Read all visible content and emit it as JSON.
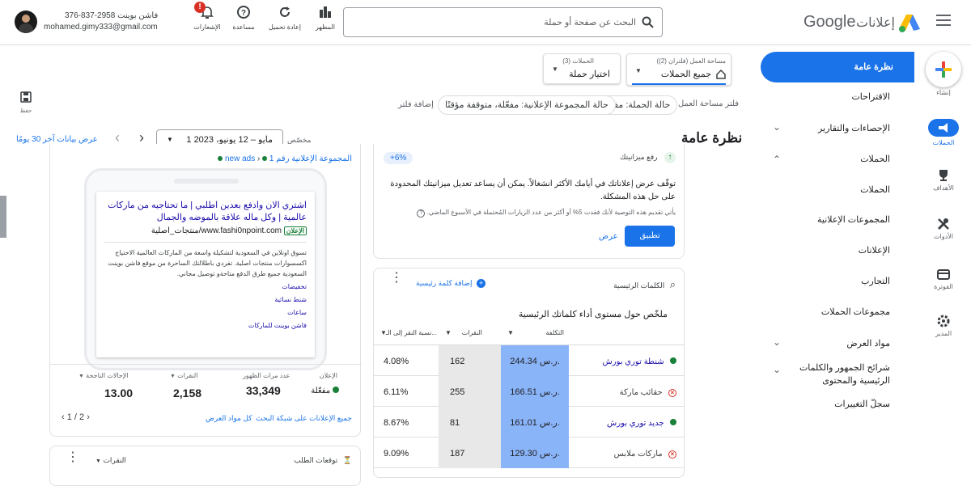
{
  "header": {
    "product_name": "إعلانات",
    "brand": "Google",
    "search_placeholder": "البحث عن صفحة أو حملة",
    "tools": [
      {
        "label": "المظهر",
        "icon": "appearance-icon"
      },
      {
        "label": "إعادة تحميل",
        "icon": "refresh-icon"
      },
      {
        "label": "مساعدة",
        "icon": "help-icon"
      },
      {
        "label": "الإشعارات",
        "icon": "bell-icon",
        "badge": "!"
      }
    ],
    "account": {
      "name": "376-837-2958 فاشن بوينت",
      "email": "mohamed.gimy333@gmail.com"
    }
  },
  "selectors": {
    "workspace_label": "مساحة العمل (فلتران (2))",
    "workspace_value": "جميع الحملات",
    "campaigns_label": "الحملات (3)",
    "campaigns_value": "اختيار حملة"
  },
  "filters": {
    "label": "فلتر مساحة العمل",
    "chips": [
      "حالة الحملة: مفعّلة",
      "حالة المجموعة الإعلانية: مفعّلة، متوقفة مؤقتًا"
    ],
    "add": "إضافة فلتر",
    "save": "حفظ"
  },
  "page": {
    "title": "نظرة عامة",
    "range_type": "مخصّص",
    "range": "1 مايو – 12 يونيو، 2023",
    "last30": "عرض بيانات آخر 30 يومًا"
  },
  "left_nav": {
    "overview": "نظرة عامة",
    "items": [
      {
        "label": "الاقتراحات"
      },
      {
        "label": "الإحصاءات والتقارير",
        "chevron": "down"
      },
      {
        "label": "الحملات",
        "chevron": "up"
      },
      {
        "label": "الحملات"
      },
      {
        "label": "المجموعات الإعلانية"
      },
      {
        "label": "الإعلانات"
      },
      {
        "label": "التجارب"
      },
      {
        "label": "مجموعات الحملات"
      },
      {
        "label": "مواد العرض",
        "chevron": "down"
      },
      {
        "label": "شرائح الجمهور والكلمات الرئيسية والمحتوى",
        "chevron": "down"
      },
      {
        "label": "سجلّ التغييرات"
      }
    ]
  },
  "rail": [
    {
      "label": "إنشاء",
      "icon": "plus-icon"
    },
    {
      "label": "الحملات",
      "icon": "campaigns-icon",
      "active": true
    },
    {
      "label": "الأهداف",
      "icon": "trophy-icon"
    },
    {
      "label": "الأدوات",
      "icon": "tools-icon"
    },
    {
      "label": "الفوترة",
      "icon": "billing-icon"
    },
    {
      "label": "المدير",
      "icon": "settings-icon"
    }
  ],
  "budget_card": {
    "title": "رفع ميزانيتك",
    "badge": "+6%",
    "text": "توقّف عرض إعلاناتك في أيامك الأكثر انشغالاً. يمكن أن يساعد تعديل ميزانيتك المحدودة على حل هذه المشكلة.",
    "note": "يأتي تقديم هذه التوصية لأنك فقدت 5% أو أكثر من عدد الزيارات المُحتملة في الأسبوع الماضي.",
    "apply": "تطبيق",
    "view": "عرض"
  },
  "keywords_card": {
    "title": "الكلمات الرئيسية",
    "add": "إضافة كلمة رئيسية",
    "summary": "ملخّص حول مستوى أداء كلماتك الرئيسية",
    "columns": [
      "التكلفة",
      "النقرات",
      "نسبة النقر إلى الـ..."
    ],
    "rows": [
      {
        "keyword": "شنطة توري بورش",
        "status": "active",
        "cost": "244.34 ر.س.",
        "clicks": "162",
        "ctr": "4.08%"
      },
      {
        "keyword": "حقائب ماركة",
        "status": "removed",
        "cost": "166.51 ر.س.",
        "clicks": "255",
        "ctr": "6.11%"
      },
      {
        "keyword": "جديد توري بورش",
        "status": "active",
        "cost": "161.01 ر.س.",
        "clicks": "81",
        "ctr": "8.67%"
      },
      {
        "keyword": "ماركات ملابس",
        "status": "removed",
        "cost": "129.30 ر.س.",
        "clicks": "187",
        "ctr": "9.09%"
      }
    ]
  },
  "ad_card": {
    "breadcrumb_campaign": "new ads",
    "breadcrumb_group": "المجموعة الإعلانية رقم 1",
    "headline": "اشتري الان وادفع بعدين اطلبي | ما تحتاجيه من ماركات عالمية | وكل ماله علاقة بالموضه والجمال",
    "ad_tag": "الإعلان",
    "url": "www.fashi0npoint.com/منتجات_اصلية",
    "description": "تسوق اونلاين في السعودية لتشكيلة واسعة من الماركات العالمية الاحتياج اكسسوارات منتجات اصلية. تفردي باطلالتك الساحرة من موقع فاشن بوينت السعودية جميع طرق الدفع متاحةو توصيل مجاني.",
    "sitelinks": [
      "تخفيضات",
      "شنط نسائية",
      "ساعات",
      "فاشن بوينت للماركات"
    ],
    "stats": [
      {
        "label": "الإعلان",
        "value": "مفعّلة"
      },
      {
        "label": "عدد مرات الظهور",
        "value": "33,349"
      },
      {
        "label": "النقرات",
        "value": "2,158"
      },
      {
        "label": "الإحالات الناجحة",
        "value": "13.00"
      }
    ],
    "footer_link1": "جميع الإعلانات على شبكة البحث",
    "footer_link2": "كل مواد العرض",
    "pager": "1 / 2"
  },
  "bottom_left": {
    "title": "توقعات الطلب",
    "metric": "النقرات"
  },
  "colors": {
    "primary": "#1a73e8",
    "cost_col": "#8ab4f8",
    "clicks_col": "#e8e8e8",
    "bar": "#3c4043"
  }
}
